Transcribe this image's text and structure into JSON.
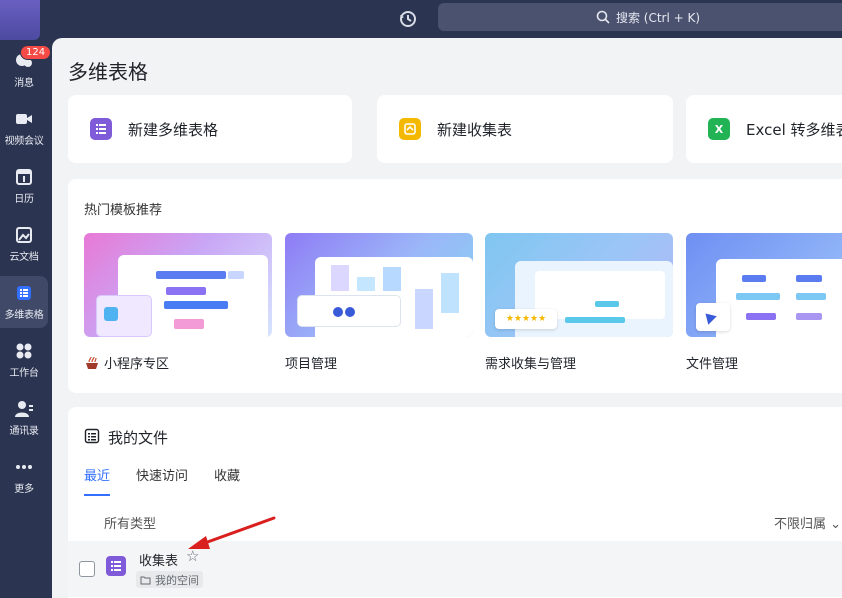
{
  "sidebar": {
    "badge_count": "124",
    "items": [
      {
        "label": "消息",
        "icon": "chat-icon"
      },
      {
        "label": "视频会议",
        "icon": "video-icon"
      },
      {
        "label": "日历",
        "icon": "calendar-icon"
      },
      {
        "label": "云文档",
        "icon": "document-icon"
      },
      {
        "label": "多维表格",
        "icon": "table-icon",
        "active": true
      },
      {
        "label": "工作台",
        "icon": "apps-icon"
      },
      {
        "label": "通讯录",
        "icon": "contacts-icon"
      },
      {
        "label": "更多",
        "icon": "more-icon"
      }
    ]
  },
  "topbar": {
    "search_placeholder": "搜索 (Ctrl + K)"
  },
  "page": {
    "title": "多维表格"
  },
  "actions": [
    {
      "label": "新建多维表格",
      "icon": "bitable-icon",
      "color": "#7f5ad9"
    },
    {
      "label": "新建收集表",
      "icon": "form-icon",
      "color": "#f5b800"
    },
    {
      "label": "Excel 转多维表",
      "icon": "excel-icon",
      "color": "#21b354"
    }
  ],
  "templates": {
    "section_title": "热门模板推荐",
    "items": [
      {
        "name": "小程序专区"
      },
      {
        "name": "项目管理"
      },
      {
        "name": "需求收集与管理"
      },
      {
        "name": "文件管理"
      }
    ]
  },
  "files": {
    "title": "我的文件",
    "tabs": [
      "最近",
      "快速访问",
      "收藏"
    ],
    "filter_type": "所有类型",
    "filter_owner": "不限归属",
    "rows": [
      {
        "name": "收集表",
        "location": "我的空间"
      }
    ]
  },
  "colors": {
    "accent": "#3370ff",
    "sidebar_bg": "#2b3450",
    "badge": "#f54a45",
    "annotation_arrow": "#d9201f"
  }
}
